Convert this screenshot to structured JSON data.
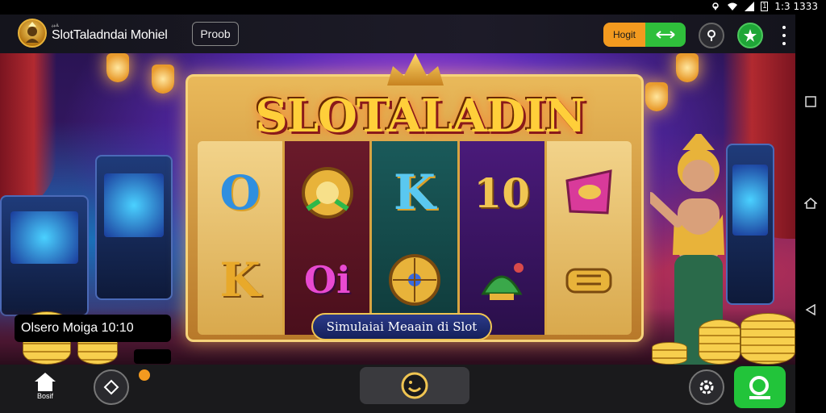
{
  "status_bar": {
    "time": "1:3 1333",
    "battery": "1"
  },
  "header": {
    "logo_tiny": "ﺔﺒﻳ",
    "app_title": "SlotTaladndai Mohiel",
    "tab_chip": "Proob",
    "mode_toggle": {
      "left_label": "Hogit"
    }
  },
  "game": {
    "title": "SLOTALADIN",
    "subtitle": "Simulaiai Meaain di Slot",
    "reels": {
      "top": [
        "O",
        "",
        "K",
        "10",
        ""
      ],
      "bottom": [
        "K",
        "Oi",
        "",
        "",
        ""
      ]
    }
  },
  "overlay": {
    "timer_text": "Olsero Moiga 10:10"
  },
  "bottom_bar": {
    "home_label": "Bosif"
  },
  "colors": {
    "accent_orange": "#f39a1f",
    "accent_green": "#22c43a",
    "title_gold": "#ffcf3a"
  },
  "icons": {
    "logo": "genie-logo-icon",
    "search": "search-icon",
    "star": "star-icon",
    "more": "more-vert-icon",
    "home": "home-icon",
    "game": "game-icon",
    "smile": "smile-icon",
    "settings": "gear-icon",
    "go": "search-go-icon"
  }
}
